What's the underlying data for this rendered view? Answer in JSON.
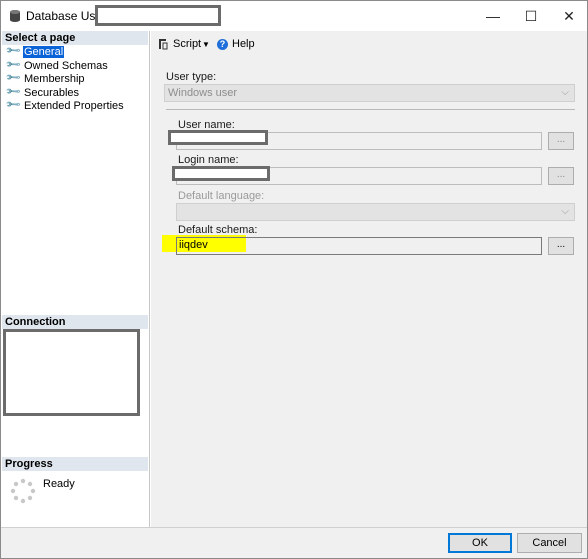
{
  "window": {
    "title": "Database User -",
    "minimize_glyph": "—",
    "maximize_glyph": "☐",
    "close_glyph": "✕"
  },
  "sidebar": {
    "select_page_header": "Select a page",
    "items": [
      {
        "label": "General",
        "selected": true
      },
      {
        "label": "Owned Schemas"
      },
      {
        "label": "Membership"
      },
      {
        "label": "Securables"
      },
      {
        "label": "Extended Properties"
      }
    ],
    "connection_header": "Connection",
    "progress_header": "Progress",
    "progress_status": "Ready"
  },
  "toolbar": {
    "script_label": "Script",
    "help_label": "Help"
  },
  "form": {
    "user_type_label": "User type:",
    "user_type_value": "Windows user",
    "user_name_label": "User name:",
    "login_name_label": "Login name:",
    "default_language_label": "Default language:",
    "default_schema_label": "Default schema:",
    "default_schema_value": "iiqdev",
    "ellipsis": "..."
  },
  "buttons": {
    "ok": "OK",
    "cancel": "Cancel"
  },
  "colors": {
    "selected_bg": "#0a64d8",
    "section_header_bg": "#dfe6ee",
    "highlight": "#ffff00",
    "default_button_border": "#0078d7"
  }
}
